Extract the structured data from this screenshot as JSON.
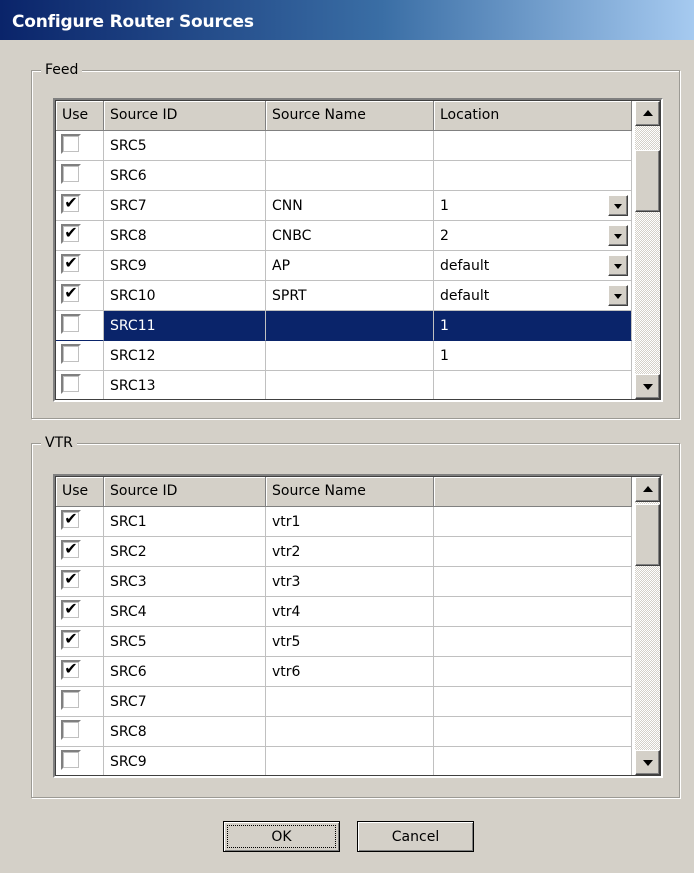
{
  "window": {
    "title": "Configure Router Sources"
  },
  "feed": {
    "label": "Feed",
    "columns": [
      "Use",
      "Source ID",
      "Source Name",
      "Location"
    ],
    "rows": [
      {
        "use": false,
        "id": "SRC5",
        "name": "",
        "location": "",
        "dropdown": false,
        "selected": false
      },
      {
        "use": false,
        "id": "SRC6",
        "name": "",
        "location": "",
        "dropdown": false,
        "selected": false
      },
      {
        "use": true,
        "id": "SRC7",
        "name": "CNN",
        "location": "1",
        "dropdown": true,
        "selected": false
      },
      {
        "use": true,
        "id": "SRC8",
        "name": "CNBC",
        "location": "2",
        "dropdown": true,
        "selected": false
      },
      {
        "use": true,
        "id": "SRC9",
        "name": "AP",
        "location": "default",
        "dropdown": true,
        "selected": false
      },
      {
        "use": true,
        "id": "SRC10",
        "name": "SPRT",
        "location": "default",
        "dropdown": true,
        "selected": false
      },
      {
        "use": false,
        "id": "SRC11",
        "name": "",
        "location": "1",
        "dropdown": false,
        "selected": true
      },
      {
        "use": false,
        "id": "SRC12",
        "name": "",
        "location": "1",
        "dropdown": false,
        "selected": false
      },
      {
        "use": false,
        "id": "SRC13",
        "name": "",
        "location": "",
        "dropdown": false,
        "selected": false
      }
    ]
  },
  "vtr": {
    "label": "VTR",
    "columns": [
      "Use",
      "Source ID",
      "Source Name",
      ""
    ],
    "rows": [
      {
        "use": true,
        "id": "SRC1",
        "name": "vtr1"
      },
      {
        "use": true,
        "id": "SRC2",
        "name": "vtr2"
      },
      {
        "use": true,
        "id": "SRC3",
        "name": "vtr3"
      },
      {
        "use": true,
        "id": "SRC4",
        "name": "vtr4"
      },
      {
        "use": true,
        "id": "SRC5",
        "name": "vtr5"
      },
      {
        "use": true,
        "id": "SRC6",
        "name": "vtr6"
      },
      {
        "use": false,
        "id": "SRC7",
        "name": ""
      },
      {
        "use": false,
        "id": "SRC8",
        "name": ""
      },
      {
        "use": false,
        "id": "SRC9",
        "name": ""
      }
    ]
  },
  "buttons": {
    "ok": "OK",
    "cancel": "Cancel"
  },
  "icons": {
    "check": "✔",
    "scroll_up": "scroll-up-arrow-icon",
    "scroll_down": "scroll-down-arrow-icon",
    "dropdown": "dropdown-arrow-icon"
  },
  "colors": {
    "title_start": "#0a246a",
    "title_end": "#a6caf0",
    "selection": "#0a246a",
    "face": "#d4d0c8"
  }
}
